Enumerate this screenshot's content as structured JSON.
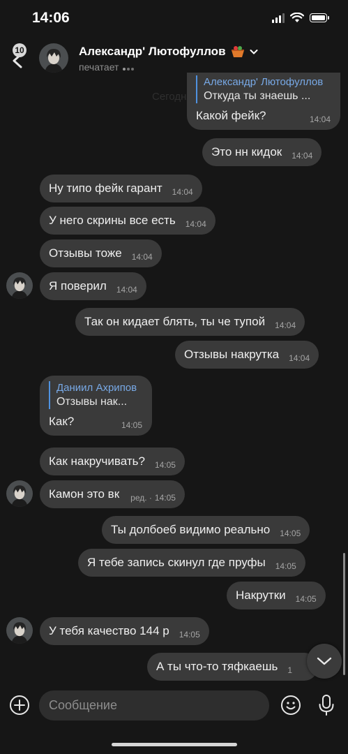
{
  "status_bar": {
    "time": "14:06"
  },
  "header": {
    "unread_count": "10",
    "name": "Александр' Лютофуллов",
    "status": "печатает"
  },
  "ghost_date": "Сегодня",
  "messages": [
    {
      "dir": "out",
      "reply": {
        "name": "Александр' Лютофуллов",
        "text": "Откуда ты знаешь ..."
      },
      "text": "Какой фейк?",
      "time": "14:04"
    },
    {
      "dir": "out",
      "text": "Это нн кидок",
      "time": "14:04"
    },
    {
      "dir": "in",
      "text": "Ну типо фейк гарант",
      "time": "14:04"
    },
    {
      "dir": "in",
      "text": "У него скрины все есть",
      "time": "14:04"
    },
    {
      "dir": "in",
      "text": "Отзывы тоже",
      "time": "14:04"
    },
    {
      "dir": "in",
      "text": "Я поверил",
      "time": "14:04"
    },
    {
      "dir": "out",
      "text": "Так он кидает блять, ты че тупой",
      "time": "14:04"
    },
    {
      "dir": "out",
      "text": "Отзывы накрутка",
      "time": "14:04"
    },
    {
      "dir": "in",
      "reply": {
        "name": "Даниил Ахрипов",
        "text": "Отзывы нак..."
      },
      "text": "Как?",
      "time": "14:05"
    },
    {
      "dir": "in",
      "text": "Как накручивать?",
      "time": "14:05"
    },
    {
      "dir": "in",
      "text": "Камон это вк",
      "edited": "ред. ·",
      "time": "14:05"
    },
    {
      "dir": "out",
      "text": "Ты долбоеб видимо реально",
      "time": "14:05"
    },
    {
      "dir": "out",
      "text": "Я тебе запись скинул где пруфы",
      "time": "14:05"
    },
    {
      "dir": "out",
      "text": "Накрутки",
      "time": "14:05"
    },
    {
      "dir": "in",
      "text": "У тебя качество 144 р",
      "time": "14:05"
    },
    {
      "dir": "out",
      "text": "А ты что-то тяфкаешь",
      "time": "1"
    }
  ],
  "composer": {
    "placeholder": "Сообщение"
  },
  "icons": {
    "back": "chevron-left-icon",
    "profile": "avatar-anime-boy",
    "emoji_badge": "basket-emoji-icon",
    "add": "plus-circle-icon",
    "emoji": "smiley-icon",
    "mic": "microphone-icon",
    "scroll_down": "chevron-down-icon"
  },
  "colors": {
    "background": "#161616",
    "bubble": "#3a3a3a",
    "reply_accent": "#4f92e0"
  }
}
